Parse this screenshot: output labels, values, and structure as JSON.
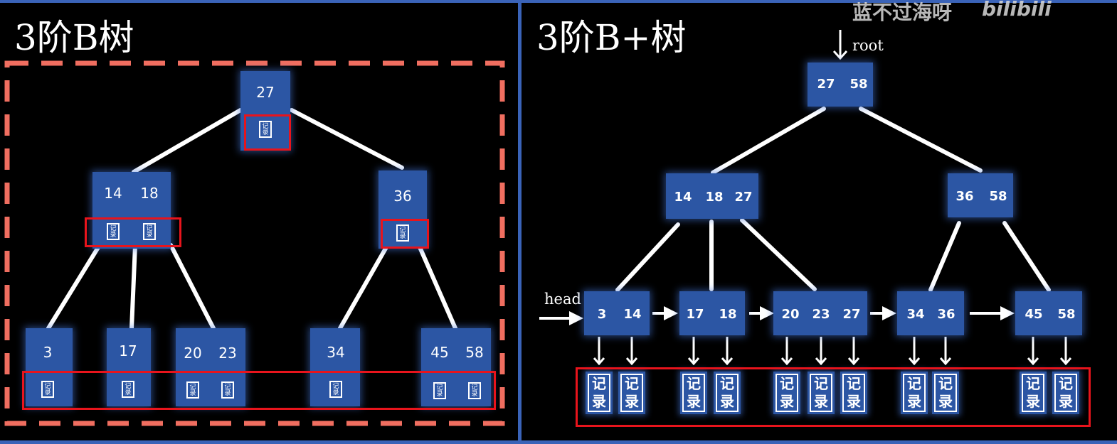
{
  "watermark": {
    "text": "蓝不过海呀",
    "logo": "bilibili"
  },
  "btree": {
    "title": "3阶B树",
    "record_label": "记录",
    "root": {
      "keys": [
        "27"
      ]
    },
    "internal": [
      {
        "keys": [
          "14",
          "18"
        ]
      },
      {
        "keys": [
          "36"
        ]
      }
    ],
    "leaves": [
      {
        "keys": [
          "3"
        ]
      },
      {
        "keys": [
          "17"
        ]
      },
      {
        "keys": [
          "20",
          "23"
        ]
      },
      {
        "keys": [
          "34"
        ]
      },
      {
        "keys": [
          "45",
          "58"
        ]
      }
    ]
  },
  "bplus": {
    "title": "3阶B+树",
    "root_label": "root",
    "head_label": "head",
    "record_label": "记录",
    "root": {
      "keys": [
        "27",
        "58"
      ]
    },
    "internal": [
      {
        "keys": [
          "14",
          "18",
          "27"
        ]
      },
      {
        "keys": [
          "36",
          "58"
        ]
      }
    ],
    "leaves": [
      {
        "keys": [
          "3",
          "14"
        ]
      },
      {
        "keys": [
          "17",
          "18"
        ]
      },
      {
        "keys": [
          "20",
          "23",
          "27"
        ]
      },
      {
        "keys": [
          "34",
          "36"
        ]
      },
      {
        "keys": [
          "45",
          "58"
        ]
      }
    ]
  },
  "colors": {
    "node": "#2c56a4",
    "highlight_red": "#e8141c",
    "dashed_border": "#f06e60",
    "panel_border": "#3a63b8"
  }
}
